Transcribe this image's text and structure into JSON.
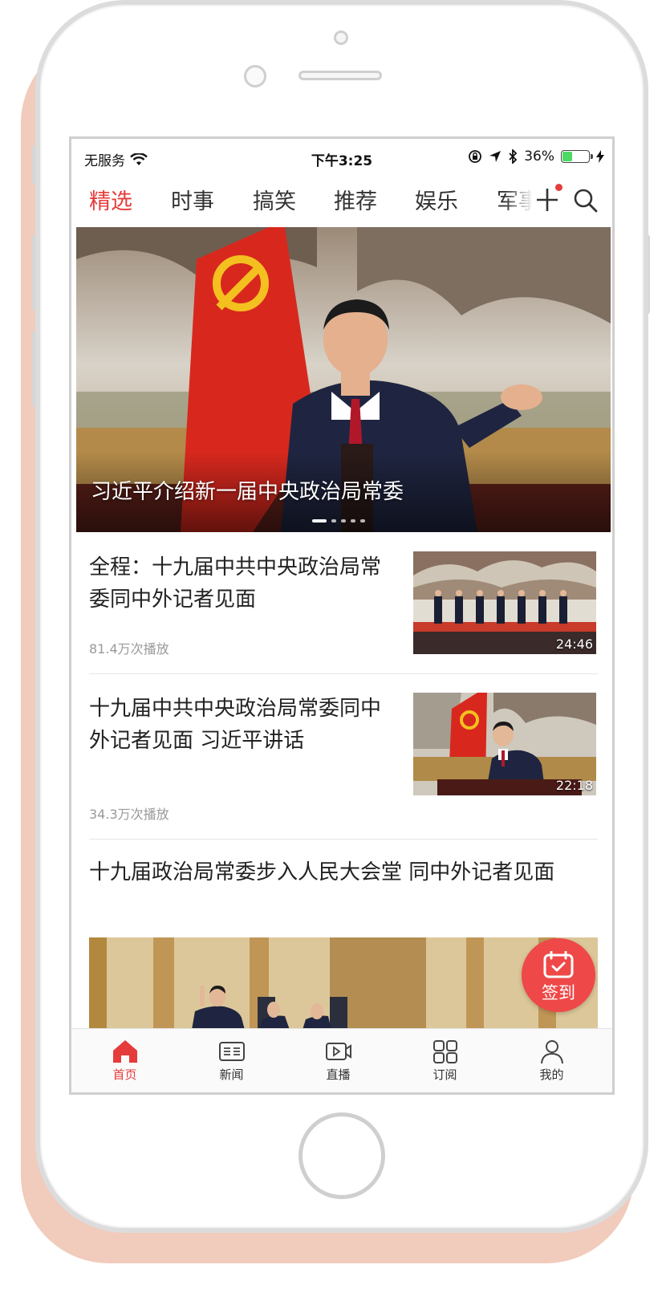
{
  "status_bar": {
    "carrier": "无服务",
    "time": "下午3:25",
    "battery_percent": "36%",
    "battery_level": 0.36
  },
  "tabs": [
    "精选",
    "时事",
    "搞笑",
    "推荐",
    "娱乐",
    "军事"
  ],
  "active_tab_index": 0,
  "hero": {
    "caption": "习近平介绍新一届中央政治局常委",
    "slide_count": 5,
    "active_slide": 0
  },
  "news": [
    {
      "title": "全程：十九届中共中央政治局常委同中外记者见面",
      "plays": "81.4万次播放",
      "duration": "24:46"
    },
    {
      "title": "十九届中共中央政治局常委同中外记者见面 习近平讲话",
      "plays": "34.3万次播放",
      "duration": "22:18"
    },
    {
      "title": "十九届政治局常委步入人民大会堂 同中外记者见面"
    }
  ],
  "checkin": {
    "label": "签到"
  },
  "bottom_tabs": [
    {
      "label": "首页",
      "icon": "home-icon",
      "active": true
    },
    {
      "label": "新闻",
      "icon": "news-icon",
      "active": false
    },
    {
      "label": "直播",
      "icon": "live-icon",
      "active": false
    },
    {
      "label": "订阅",
      "icon": "subscribe-icon",
      "active": false
    },
    {
      "label": "我的",
      "icon": "profile-icon",
      "active": false
    }
  ],
  "colors": {
    "accent": "#e63b3b",
    "checkin": "#ef4848",
    "frame_shadow": "#f1cbbb"
  }
}
